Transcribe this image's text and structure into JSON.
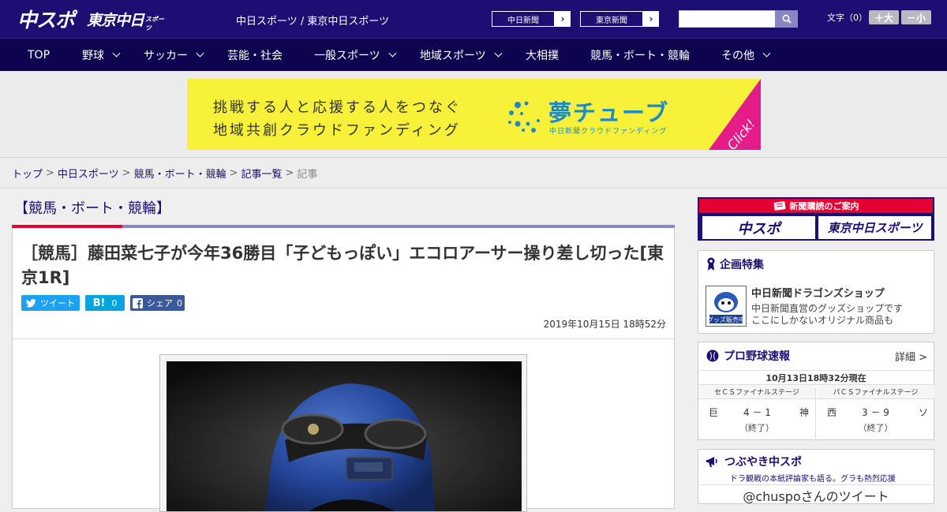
{
  "header": {
    "logo_chuspo": "中スポ",
    "logo_tokyo": "東京中日",
    "logo_tokyo_sub": "スポーツ",
    "site_title": "中日スポーツ / 東京中日スポーツ",
    "ext_links": [
      {
        "label": "中日新聞",
        "arrow": "›"
      },
      {
        "label": "東京新聞",
        "arrow": "›"
      }
    ],
    "search_placeholder": "",
    "font_size_label": "文字（0）",
    "font_larger": "＋大",
    "font_smaller": "－小",
    "colors": {
      "header_bg": "#1b0f73",
      "nav_bg": "#0d0450"
    }
  },
  "nav": {
    "items": [
      {
        "label": "TOP",
        "dropdown": false
      },
      {
        "label": "野球",
        "dropdown": true
      },
      {
        "label": "サッカー",
        "dropdown": true
      },
      {
        "label": "芸能・社会",
        "dropdown": false
      },
      {
        "label": "一般スポーツ",
        "dropdown": true
      },
      {
        "label": "地域スポーツ",
        "dropdown": true
      },
      {
        "label": "大相撲",
        "dropdown": false
      },
      {
        "label": "競馬・ボート・競輪",
        "dropdown": false
      },
      {
        "label": "その他",
        "dropdown": true
      }
    ]
  },
  "banner": {
    "line1": "挑戦する人と応援する人をつなぐ",
    "line2": "地域共創クラウドファンディング",
    "title": "夢チューブ",
    "subtitle": "中日新聞クラウドファンディング",
    "click": "Click!",
    "colors": {
      "bg": "#f7f13a",
      "accent": "#1a8ac9",
      "corner": "#e51c88"
    }
  },
  "breadcrumb": {
    "items": [
      "トップ",
      "中日スポーツ",
      "競馬・ボート・競輪",
      "記事一覧"
    ],
    "separator": ">",
    "current": "記事"
  },
  "article": {
    "section": "【競馬・ボート・競輪】",
    "title": "［競馬］藤田菜七子が今年36勝目「子どもっぽい」エコロアーサー操り差し切った[東京1R]",
    "share": {
      "tweet": "ツイート",
      "hatena_label": "B!",
      "hatena_count": "0",
      "facebook_label": "シェア",
      "facebook_count": "0"
    },
    "date": "2019年10月15日 18時52分"
  },
  "sidebar": {
    "subscribe": {
      "head": "新聞購読のご案内",
      "logo1": "中スポ",
      "logo2": "東京中日スポーツ"
    },
    "feature": {
      "head": "企画特集",
      "thumb_label": "グッズ販売中",
      "name": "中日新聞ドラゴンズショップ",
      "desc1": "中日新聞直営のグッズショップです",
      "desc2": "ここにしかないオリジナル商品も"
    },
    "scores": {
      "head": "プロ野球速報",
      "more": "詳細 >",
      "updated": "10月13日18時32分現在",
      "games": [
        {
          "stage": "セＣＳファイナルステージ",
          "team1": "巨",
          "score": "4 － 1",
          "team2": "神",
          "status": "（終了）"
        },
        {
          "stage": "パＣＳファイナルステージ",
          "team1": "西",
          "score": "3 － 9",
          "team2": "ソ",
          "status": "（終了）"
        }
      ]
    },
    "tsubuyaki": {
      "head": "つぶやき中スポ",
      "sub": "ドラ観戦の本紙評論家も語る。グラも熱烈応援",
      "tweets_head": "@chuspoさんのツイート"
    }
  }
}
